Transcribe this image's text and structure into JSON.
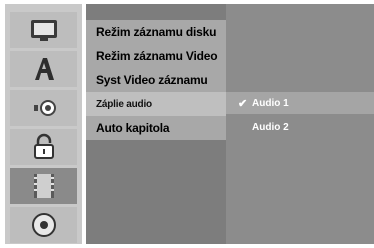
{
  "rail": {
    "icons": [
      "tv-icon",
      "letter-a-icon",
      "speaker-icon",
      "lock-icon",
      "film-icon",
      "disc-icon"
    ],
    "selected_index": 4
  },
  "menu": {
    "items": [
      {
        "label": "Režim záznamu disku"
      },
      {
        "label": "Režim záznamu Video"
      },
      {
        "label": "Syst Video záznamu"
      },
      {
        "label": "Záplie audio"
      },
      {
        "label": "Auto kapitola"
      }
    ],
    "highlighted_index": 3
  },
  "submenu": {
    "items": [
      {
        "label": "Audio 1",
        "checked": true
      },
      {
        "label": "Audio 2",
        "checked": false
      }
    ]
  }
}
